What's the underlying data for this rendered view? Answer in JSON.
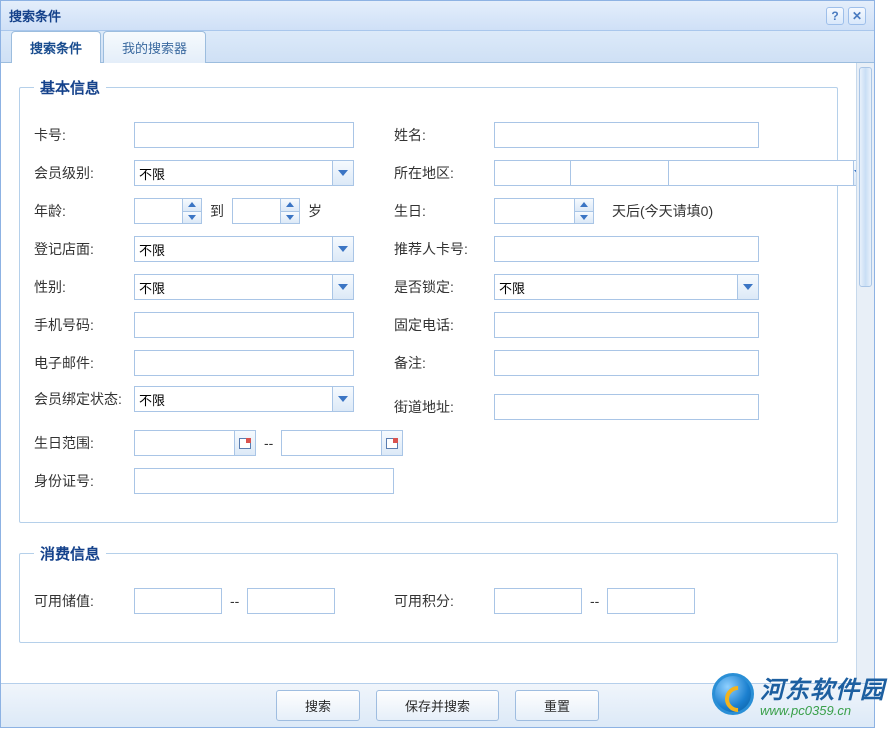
{
  "window": {
    "title": "搜索条件"
  },
  "tabs": [
    {
      "label": "搜索条件",
      "active": true
    },
    {
      "label": "我的搜索器",
      "active": false
    }
  ],
  "sections": {
    "basic": {
      "title": "基本信息"
    },
    "consume": {
      "title": "消费信息"
    }
  },
  "labels": {
    "card_no": "卡号:",
    "name": "姓名:",
    "member_level": "会员级别:",
    "region": "所在地区:",
    "age": "年龄:",
    "age_to": "到",
    "age_unit": "岁",
    "birthday": "生日:",
    "days_later": "天后(今天请填0)",
    "reg_store": "登记店面:",
    "referrer_card": "推荐人卡号:",
    "gender": "性别:",
    "locked": "是否锁定:",
    "mobile": "手机号码:",
    "phone": "固定电话:",
    "email": "电子邮件:",
    "remark": "备注:",
    "bind_status": "会员绑定状态:",
    "street": "街道地址:",
    "birthday_range": "生日范围:",
    "range_sep": "--",
    "id_card": "身份证号:",
    "avail_balance": "可用储值:",
    "avail_points": "可用积分:"
  },
  "values": {
    "card_no": "",
    "name": "",
    "member_level": "不限",
    "region1": "",
    "region2": "",
    "region3": "",
    "age_from": "",
    "age_to": "",
    "birthday_days": "",
    "reg_store": "不限",
    "referrer_card": "",
    "gender": "不限",
    "locked": "不限",
    "mobile": "",
    "phone": "",
    "email": "",
    "remark": "",
    "bind_status": "不限",
    "street": "",
    "birthday_from": "",
    "birthday_to": "",
    "id_card": "",
    "balance_from": "",
    "balance_to": "",
    "points_from": "",
    "points_to": ""
  },
  "buttons": {
    "search": "搜索",
    "save_search": "保存并搜索",
    "reset": "重置",
    "help": "?",
    "close": "✕"
  },
  "watermark": {
    "cn": "河东软件园",
    "en": "www.pc0359.cn"
  }
}
